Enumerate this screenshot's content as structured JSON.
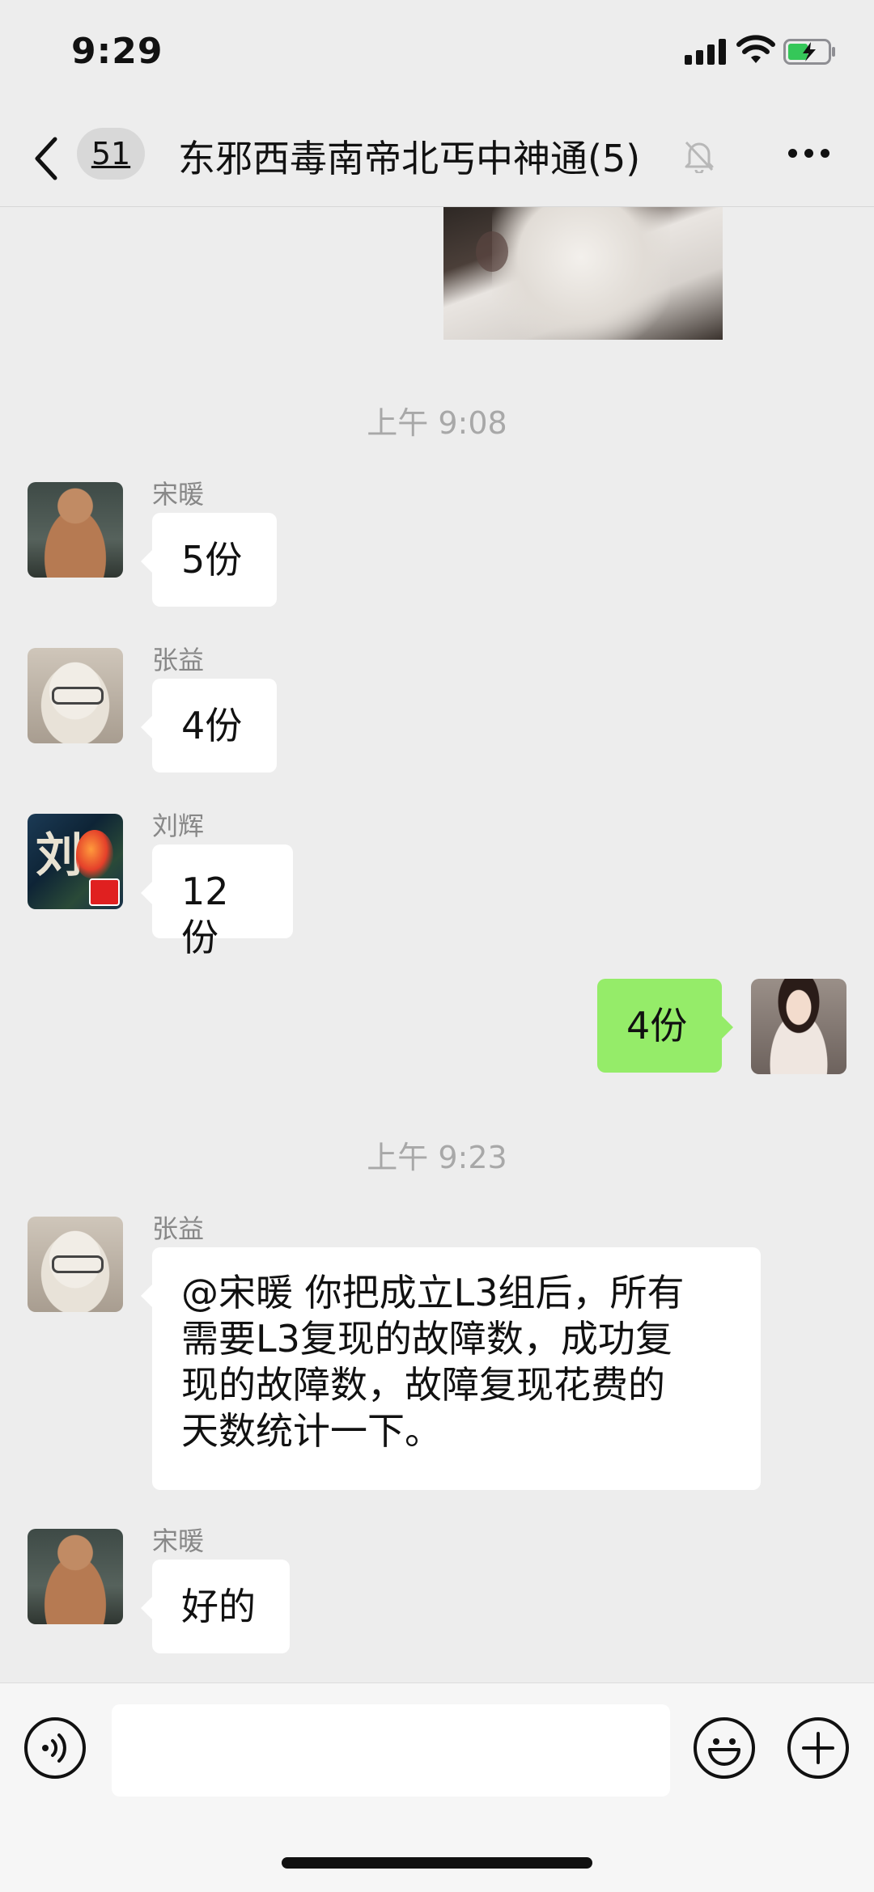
{
  "status_bar": {
    "time": "9:29"
  },
  "nav": {
    "unread_count": "51",
    "title": "东邪西毒南帝北丐中神通(5)"
  },
  "messages": {
    "time_1": "上午 9:08",
    "m1": {
      "sender": "宋暖",
      "text": "5份"
    },
    "m2": {
      "sender": "张益",
      "text": "4份"
    },
    "m3": {
      "sender": "刘辉",
      "text": "12份"
    },
    "m4": {
      "text": "4份"
    },
    "time_2": "上午 9:23",
    "m5": {
      "sender": "张益",
      "lines": [
        "@宋暖 你把成立L3组后，所有",
        "需要L3复现的故障数，成功复",
        "现的故障数，故障复现花费的",
        "天数统计一下。"
      ]
    },
    "m6": {
      "sender": "宋暖",
      "text": "好的"
    }
  },
  "input_bar": {
    "value": "",
    "placeholder": ""
  },
  "icons": {
    "back": "chevron-left-icon",
    "mute": "bell-slash-icon",
    "more": "more-dots-icon",
    "voice": "voice-icon",
    "emoji": "emoji-icon",
    "plus": "plus-circle-icon"
  },
  "colors": {
    "background": "#ededed",
    "my_bubble": "#95ec69",
    "other_bubble": "#ffffff",
    "battery_fill": "#35c759"
  }
}
